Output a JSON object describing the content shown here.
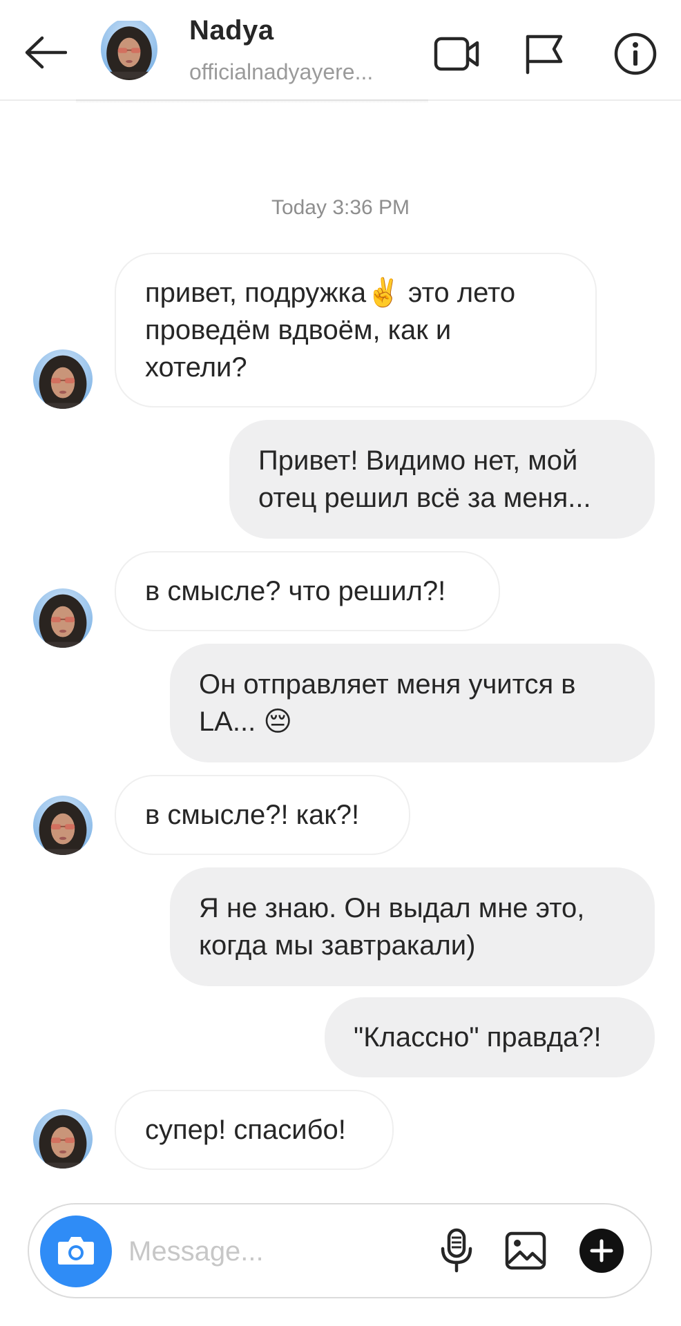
{
  "header": {
    "name": "Nadya",
    "username": "officialnadyayere..."
  },
  "chat": {
    "timestamp": "Today 3:36 PM",
    "messages": [
      {
        "direction": "in",
        "text": "привет, подружка✌️ это лето\nпроведём вдвоём, как и\nхотели?"
      },
      {
        "direction": "out",
        "text": "Привет! Видимо нет, мой\nотец решил всё за меня..."
      },
      {
        "direction": "in",
        "text": "в смысле? что решил?!"
      },
      {
        "direction": "out",
        "text": "Он отправляет меня учится в\nLA... 😔"
      },
      {
        "direction": "in",
        "text": "в смысле?! как?!"
      },
      {
        "direction": "out",
        "text": "Я не знаю. Он выдал мне это,\nкогда мы завтракали)"
      },
      {
        "direction": "out",
        "text": "\"Классно\" правда?!"
      },
      {
        "direction": "in",
        "text": "супер! спасибо!"
      }
    ]
  },
  "composer": {
    "placeholder": "Message..."
  },
  "colors": {
    "accent": "#2f8cf6",
    "outgoing_bubble": "#efeff0",
    "incoming_border": "#efefef"
  },
  "icons": [
    "back-arrow-icon",
    "video-call-icon",
    "flag-icon",
    "info-icon",
    "camera-icon",
    "microphone-icon",
    "gallery-icon",
    "plus-icon"
  ]
}
